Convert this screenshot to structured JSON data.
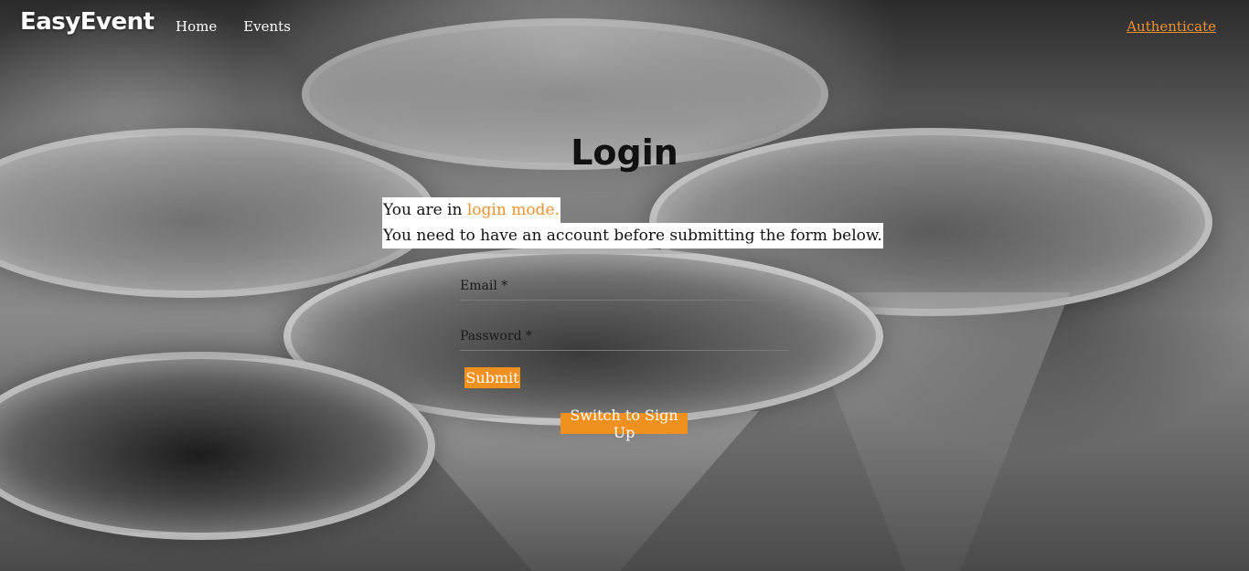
{
  "nav": {
    "brand": "EasyEvent",
    "links": [
      {
        "label": "Home"
      },
      {
        "label": "Events"
      }
    ],
    "auth_label": "Authenticate"
  },
  "main": {
    "title": "Login",
    "info_prefix": "You are in ",
    "mode_text": "login mode.",
    "info_line2": "You need to have an account before submitting the form below.",
    "email_label": "Email *",
    "email_value": "",
    "password_label": "Password *",
    "password_value": "",
    "submit_label": "Submit",
    "switch_label": "Switch to Sign Up"
  },
  "colors": {
    "accent": "#f0901e",
    "link": "#f0912c",
    "title": "#111111"
  }
}
